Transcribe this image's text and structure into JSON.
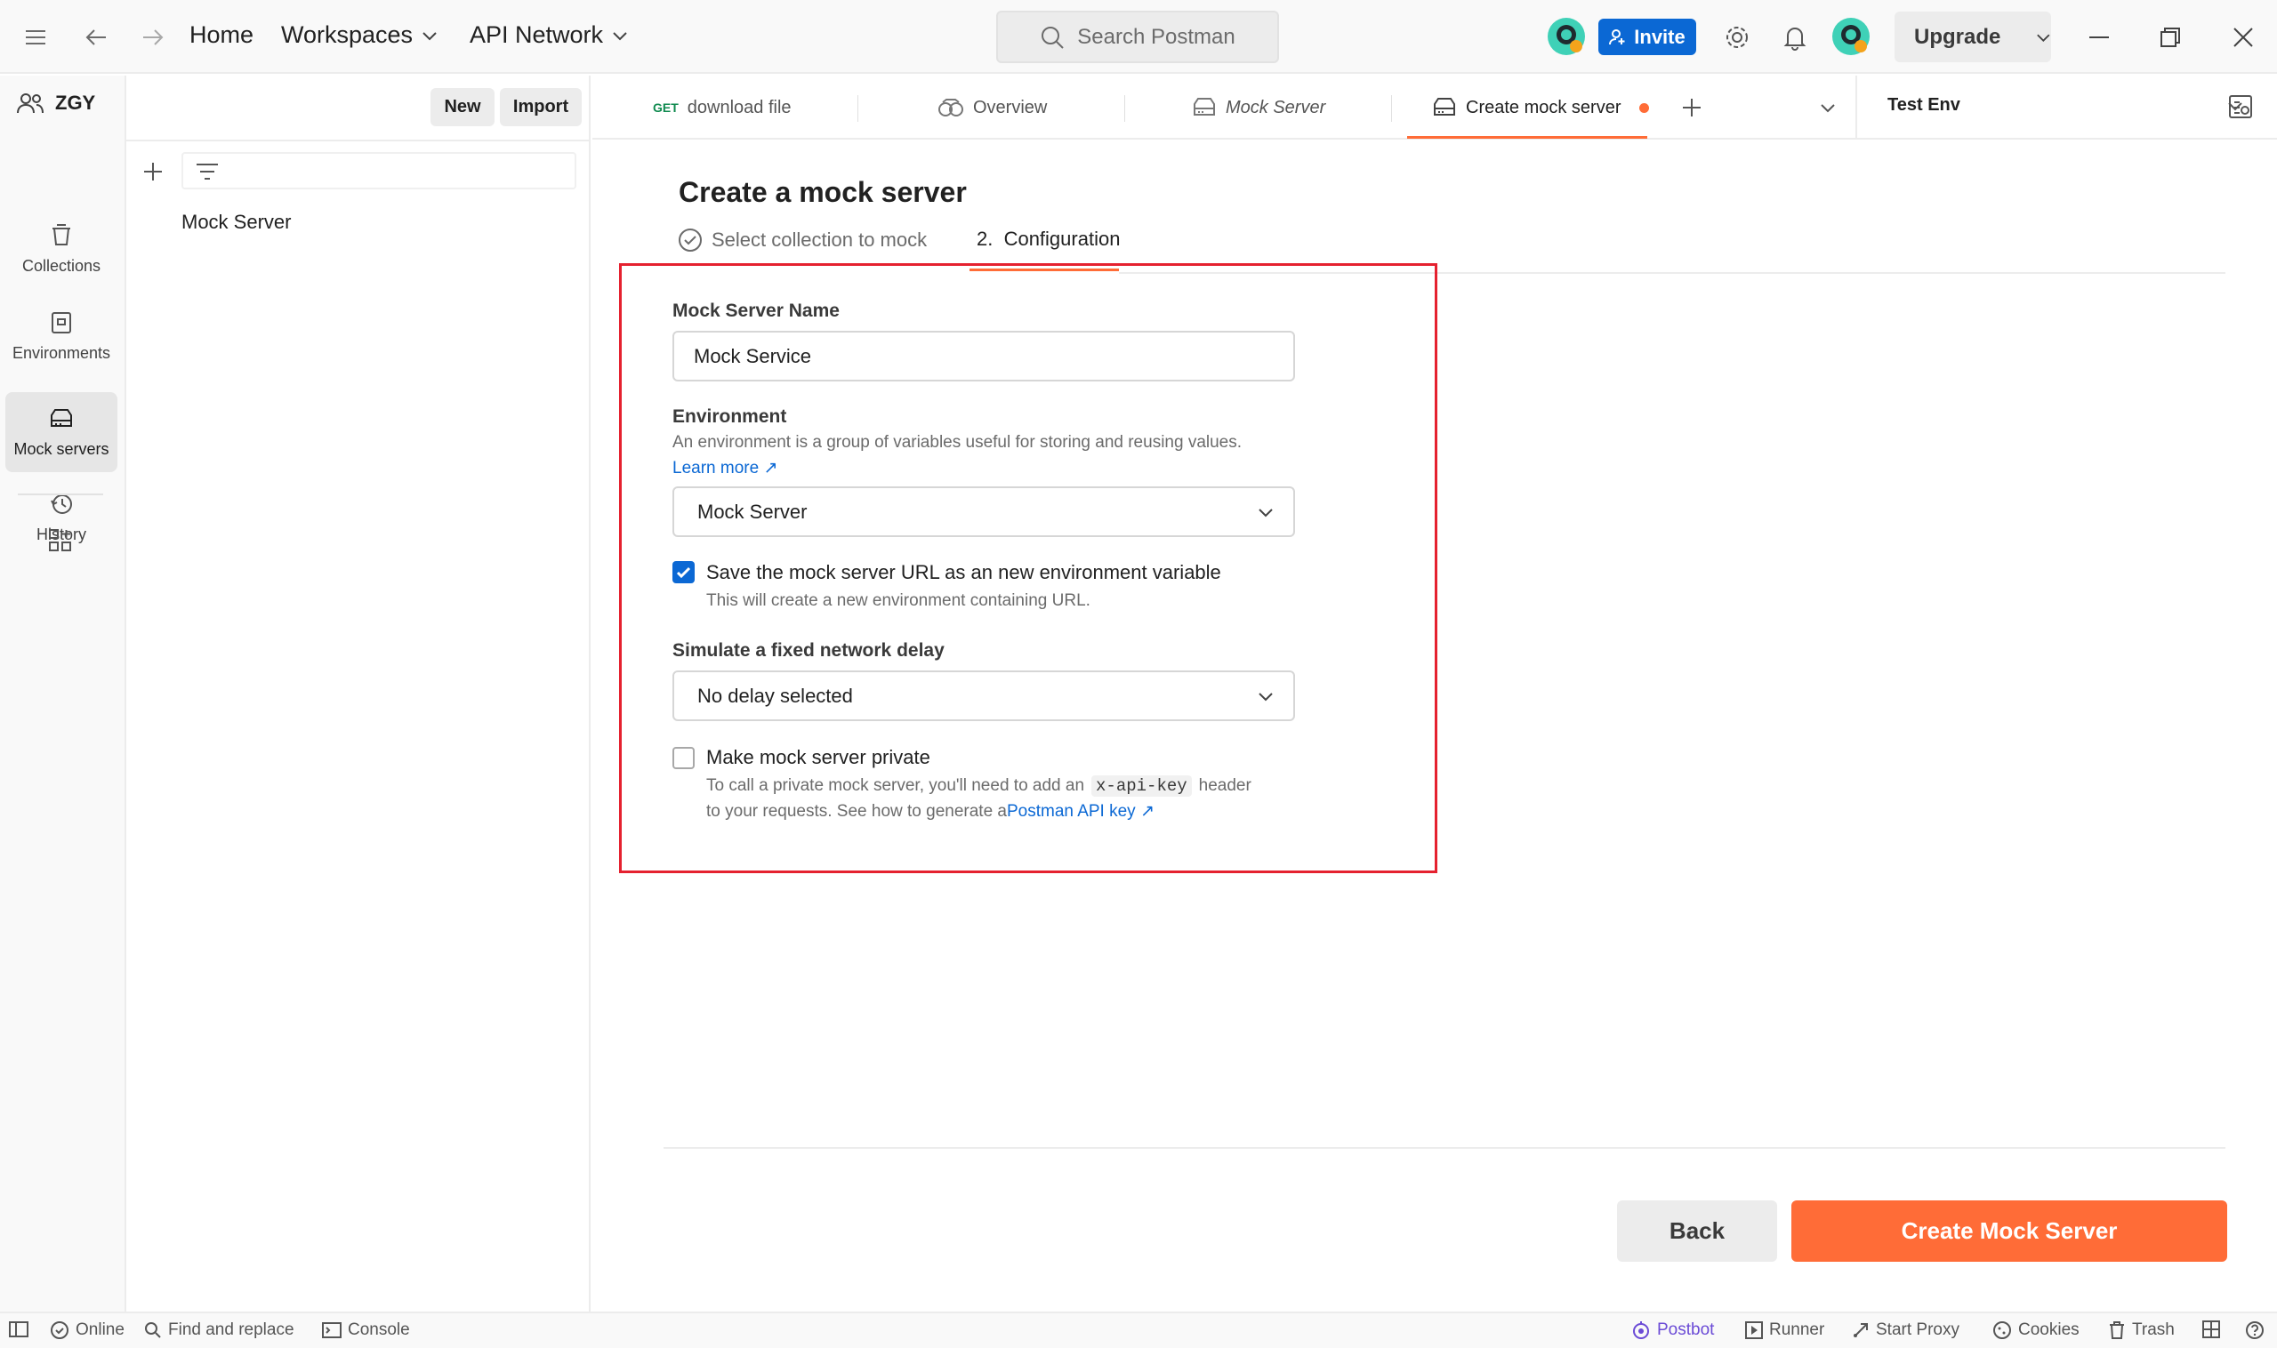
{
  "topbar": {
    "home": "Home",
    "workspaces": "Workspaces",
    "api_network": "API Network",
    "search_placeholder": "Search Postman",
    "invite": "Invite",
    "upgrade": "Upgrade"
  },
  "rail": {
    "items": [
      {
        "label": "Collections",
        "icon": "collections-icon"
      },
      {
        "label": "Environments",
        "icon": "environments-icon"
      },
      {
        "label": "Mock servers",
        "icon": "mock-servers-icon",
        "active": true
      },
      {
        "label": "History",
        "icon": "history-icon"
      }
    ]
  },
  "sidebar": {
    "workspace": "ZGY",
    "new": "New",
    "import": "Import",
    "items": [
      "Mock Server"
    ]
  },
  "tabs": {
    "items": [
      {
        "method": "GET",
        "label": "download file"
      },
      {
        "label": "Overview"
      },
      {
        "label": "Mock Server"
      },
      {
        "label": "Create mock server",
        "active": true,
        "unsaved": true
      }
    ],
    "environment": "Test Env"
  },
  "form": {
    "title": "Create a mock server",
    "step1": "Select collection to mock",
    "step2": "2.  Configuration",
    "name_label": "Mock Server Name",
    "name_value": "Mock Service",
    "env_label": "Environment",
    "env_help": "An environment is a group of variables useful for storing and reusing values.",
    "learn_more": "Learn more ↗",
    "env_value": "Mock Server",
    "save_url_label": "Save the mock server URL as an new environment variable",
    "save_url_checked": true,
    "save_url_help": "This will create a new environment containing URL.",
    "delay_label": "Simulate a fixed network delay",
    "delay_value": "No delay selected",
    "private_label": "Make mock server private",
    "private_checked": false,
    "private_help_1": "To call a private mock server, you'll need to add an",
    "private_help_code": "x-api-key",
    "private_help_2": "header",
    "private_help_3": "to your requests. See how to generate a",
    "private_help_link": "Postman API key ↗",
    "back": "Back",
    "create": "Create Mock Server"
  },
  "statusbar": {
    "online": "Online",
    "find_replace": "Find and replace",
    "console": "Console",
    "postbot": "Postbot",
    "runner": "Runner",
    "start_proxy": "Start Proxy",
    "cookies": "Cookies",
    "trash": "Trash"
  },
  "colors": {
    "accent": "#ff6c37",
    "link": "#0b68d4",
    "highlight_box": "#e5212f"
  }
}
